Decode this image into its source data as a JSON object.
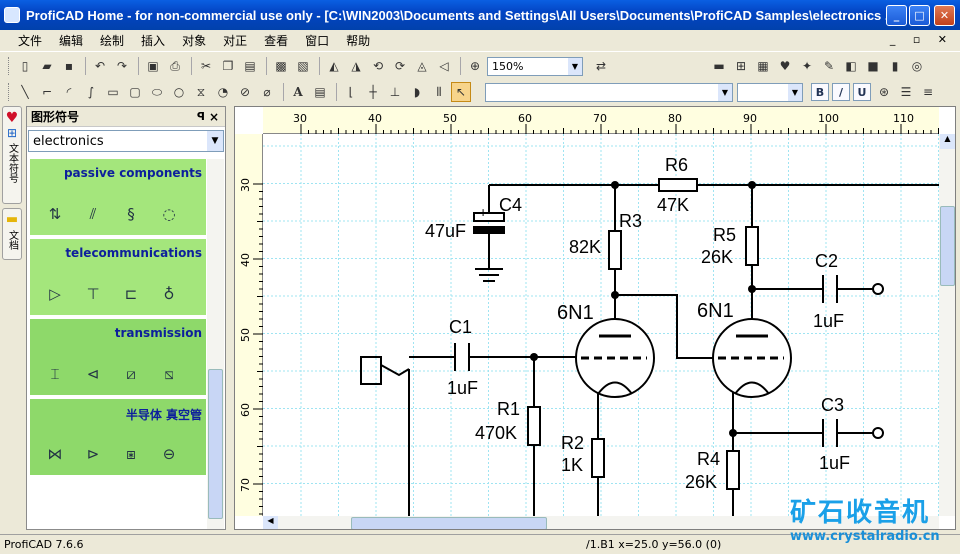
{
  "window": {
    "title": "ProfiCAD Home - for non-commercial use only - [C:\\WIN2003\\Documents and Settings\\All Users\\Documents\\ProfiCAD Samples\\electronics ...",
    "controls": [
      "_",
      "□",
      "✕"
    ]
  },
  "menu": [
    "文件",
    "编辑",
    "绘制",
    "插入",
    "对象",
    "对正",
    "查看",
    "窗口",
    "帮助"
  ],
  "toolbar": {
    "zoom": "150%"
  },
  "sidetabs": [
    "文本符号",
    "文档"
  ],
  "panel": {
    "title": "图形符号",
    "pin": "ꟼ",
    "close": "×",
    "category": "electronics",
    "categories": [
      {
        "name": "passive components",
        "icons": [
          "capacitor-icon",
          "variable-capacitor-icon",
          "inductor-icon",
          "ac-source-icon"
        ]
      },
      {
        "name": "telecommunications",
        "icons": [
          "amplifier-icon",
          "antenna-icon",
          "attenuator-icon",
          "transducer-icon"
        ]
      },
      {
        "name": "transmission",
        "icons": [
          "filter-icon",
          "mixer-icon",
          "modulator-icon",
          "demodulator-icon"
        ]
      },
      {
        "name": "半导体 真空管",
        "icons": [
          "thyristor-icon",
          "diode-icon",
          "transistor-array-icon",
          "transistor-icon"
        ]
      }
    ]
  },
  "rulers": {
    "horizontal": [
      "30",
      "40",
      "50",
      "60",
      "70",
      "80",
      "90",
      "100",
      "110"
    ],
    "vertical": [
      "30",
      "40",
      "50",
      "60",
      "70"
    ]
  },
  "schematic": {
    "labels": {
      "R6": "R6",
      "R6v": "47K",
      "C4": "C4",
      "C4v": "47uF",
      "R3": "R3",
      "R3v": "82K",
      "R5": "R5",
      "R5v": "26K",
      "C2": "C2",
      "C2v": "1uF",
      "V1": "6N1",
      "V2": "6N1",
      "C1": "C1",
      "C1v": "1uF",
      "R1": "R1",
      "R1v": "470K",
      "R2": "R2",
      "R2v": "1K",
      "C3": "C3",
      "C3v": "1uF",
      "R4": "R4",
      "R4v": "26K"
    }
  },
  "status": {
    "version": "ProfiCAD 7.6.6",
    "coords": "/1.B1  x=25.0  y=56.0 (0)"
  },
  "watermark": {
    "line1": "矿石收音机",
    "line2": "www.crystalradio.cn"
  },
  "colors": {
    "title_bar": "#0345c4",
    "panel_category_bg": "#a4e67c",
    "category_text": "#0d1f9c",
    "grid": "#9fe4f2",
    "ruler_bg": "#fffee0"
  }
}
